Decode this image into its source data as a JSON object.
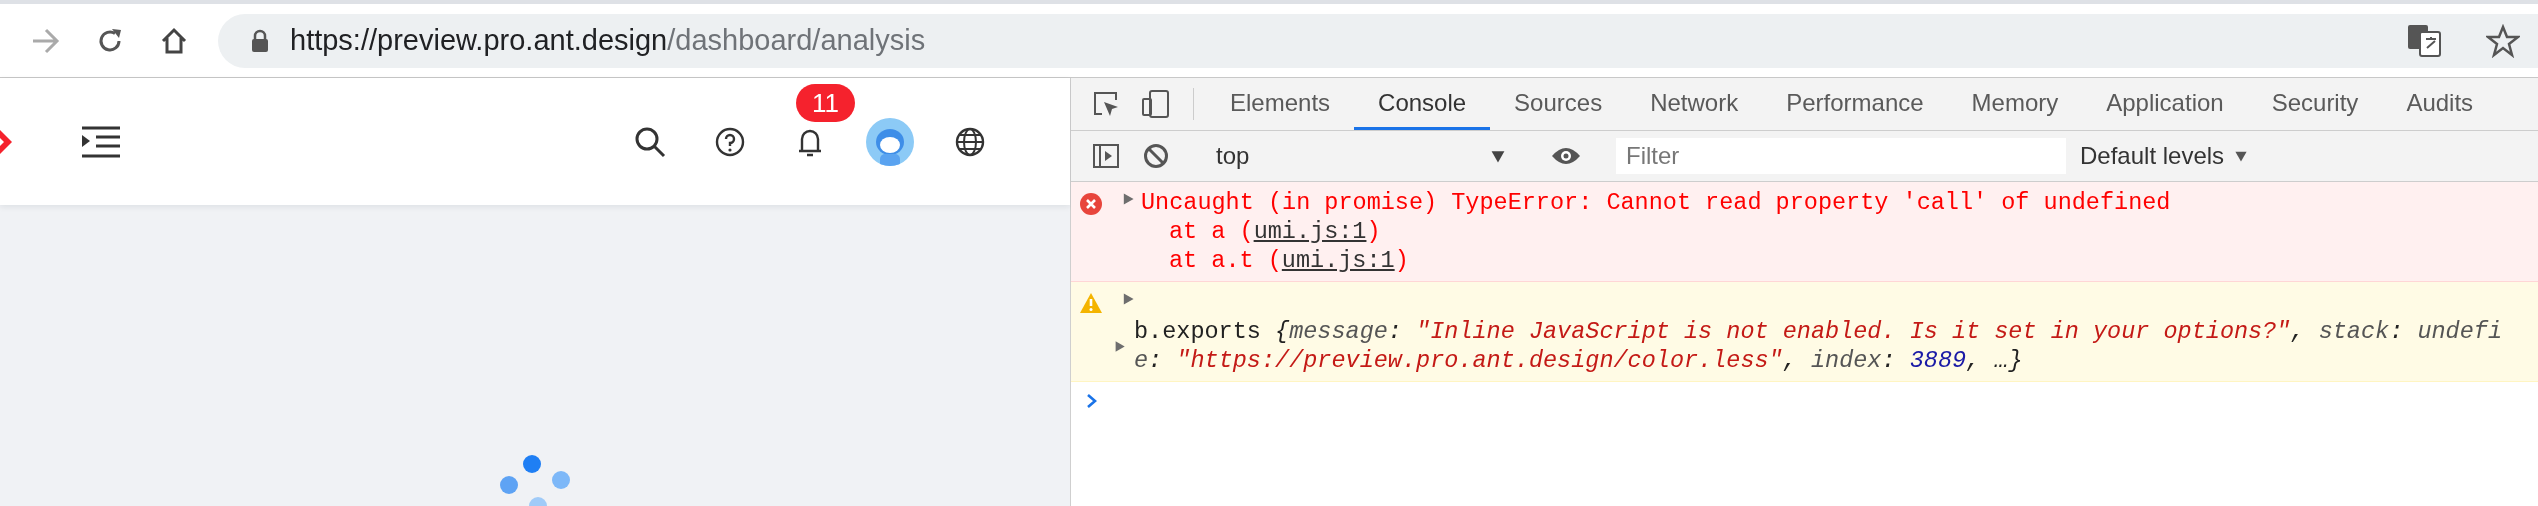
{
  "browser": {
    "url_host": "https://preview.pro.ant.design",
    "url_path": "/dashboard/analysis",
    "secure": true
  },
  "app_header": {
    "notification_count": "11"
  },
  "devtools": {
    "tabs": [
      {
        "label": "Elements",
        "selected": false
      },
      {
        "label": "Console",
        "selected": true
      },
      {
        "label": "Sources",
        "selected": false
      },
      {
        "label": "Network",
        "selected": false
      },
      {
        "label": "Performance",
        "selected": false
      },
      {
        "label": "Memory",
        "selected": false
      },
      {
        "label": "Application",
        "selected": false
      },
      {
        "label": "Security",
        "selected": false
      },
      {
        "label": "Audits",
        "selected": false
      }
    ],
    "context": "top",
    "filter": {
      "placeholder": "Filter"
    },
    "levels": "Default levels"
  },
  "console": [
    {
      "kind": "error",
      "message": "Uncaught (in promise) TypeError: Cannot read property 'call' of undefined",
      "stack": [
        {
          "prefix": "at a (",
          "link": "umi.js:1",
          "suffix": ")"
        },
        {
          "prefix": "at a.t (",
          "link": "umi.js:1",
          "suffix": ")"
        }
      ]
    },
    {
      "kind": "warning",
      "lines": [
        [
          {
            "text": "b.exports ",
            "kind": "plain"
          },
          {
            "text": "{",
            "kind": "punct"
          },
          {
            "text": "message",
            "kind": "key"
          },
          {
            "text": ": ",
            "kind": "punct"
          },
          {
            "text": "\"Inline JavaScript is not enabled. Is it set in your options?\"",
            "kind": "string"
          },
          {
            "text": ", ",
            "kind": "punct"
          },
          {
            "text": "stack",
            "kind": "key"
          },
          {
            "text": ": ",
            "kind": "punct"
          },
          {
            "text": "undefi",
            "kind": "key"
          }
        ],
        [
          {
            "text": "e",
            "kind": "key"
          },
          {
            "text": ": ",
            "kind": "punct"
          },
          {
            "text": "\"https://preview.pro.ant.design/color.less\"",
            "kind": "string"
          },
          {
            "text": ", ",
            "kind": "punct"
          },
          {
            "text": "index",
            "kind": "key"
          },
          {
            "text": ": ",
            "kind": "punct"
          },
          {
            "text": "3889",
            "kind": "number"
          },
          {
            "text": ", …}",
            "kind": "punct"
          }
        ]
      ]
    }
  ]
}
